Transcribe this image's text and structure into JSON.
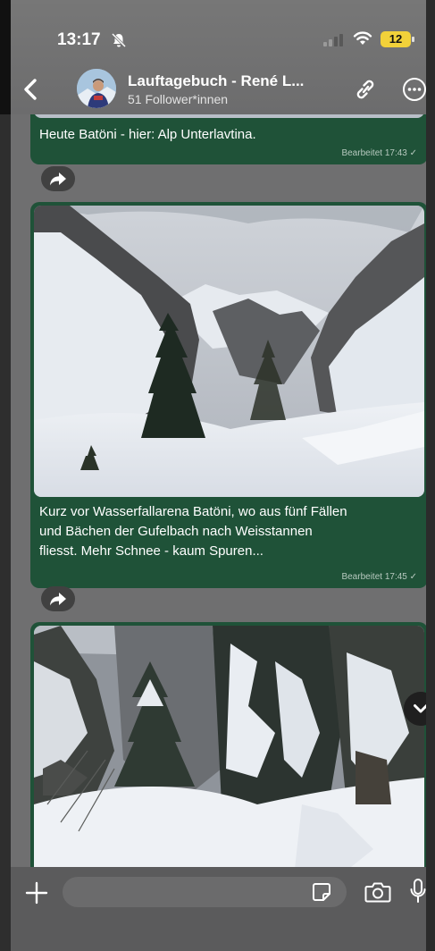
{
  "status_bar": {
    "time": "13:17",
    "battery": "12"
  },
  "header": {
    "title": "Lauftagebuch - René L...",
    "subtitle": "51 Follower*innen"
  },
  "messages": [
    {
      "caption": "Heute Batöni - hier: Alp Unterlavtina.",
      "edited": "Bearbeitet 17:43 ✓"
    },
    {
      "caption_lines": [
        "Kurz vor Wasserfallarena Batöni, wo aus fünf Fällen",
        "und Bächen der Gufelbach nach Weisstannen",
        "fliesst. Mehr Schnee - kaum Spuren..."
      ],
      "edited": "Bearbeitet 17:45 ✓"
    },
    {
      "caption": ""
    }
  ],
  "input": {
    "placeholder": ""
  },
  "colors": {
    "bubble": "#1f5238",
    "battery": "#f2d13a"
  },
  "icons": [
    "bell-slash-icon",
    "wifi-icon",
    "back-arrow-icon",
    "link-icon",
    "more-icon",
    "forward-icon",
    "chevron-down-icon",
    "plus-icon",
    "sticker-icon",
    "camera-icon",
    "mic-icon"
  ]
}
